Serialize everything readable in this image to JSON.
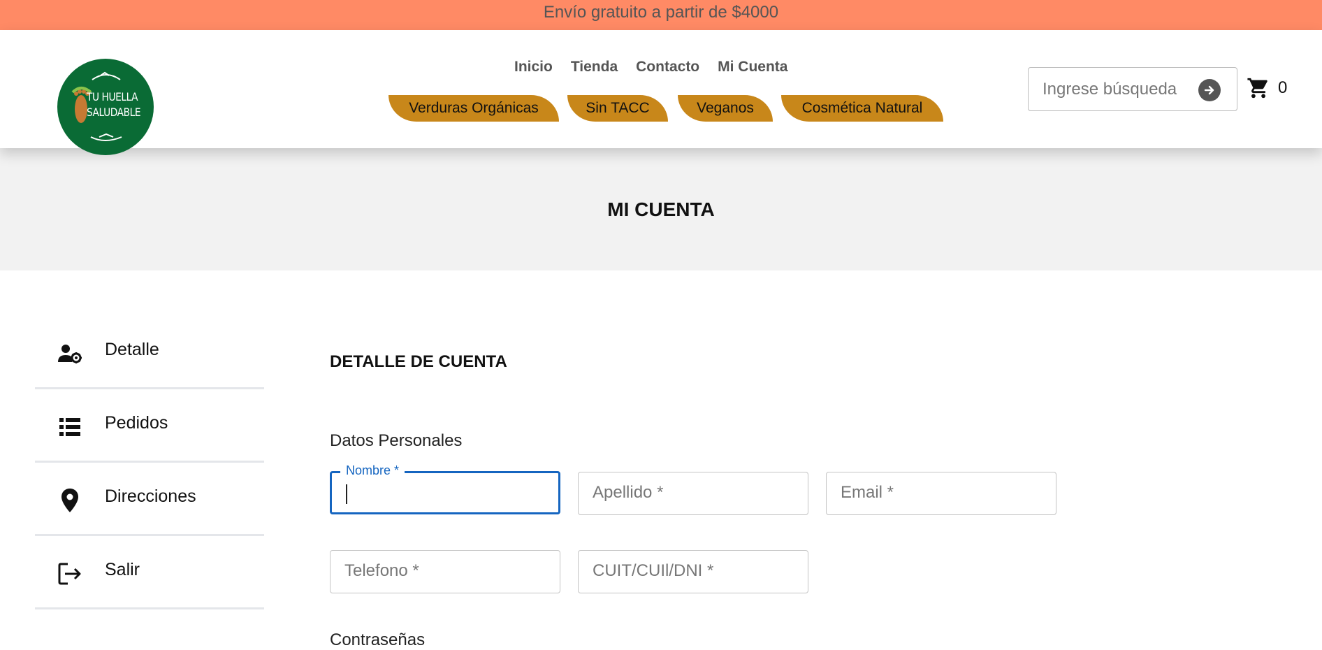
{
  "promo": {
    "text": "Envío gratuito a partir de $4000"
  },
  "logo": {
    "line1": "TU HUELLA",
    "line2": "SALUDABLE"
  },
  "nav": {
    "main": [
      "Inicio",
      "Tienda",
      "Contacto",
      "Mi Cuenta"
    ],
    "categories": [
      "Verduras Orgánicas",
      "Sin TACC",
      "Veganos",
      "Cosmética Natural"
    ]
  },
  "search": {
    "placeholder": "Ingrese búsqueda"
  },
  "cart": {
    "count": "0"
  },
  "page": {
    "title": "MI CUENTA"
  },
  "sidebar": {
    "items": [
      {
        "label": "Detalle",
        "icon": "user-gear-icon"
      },
      {
        "label": "Pedidos",
        "icon": "list-icon"
      },
      {
        "label": "Direcciones",
        "icon": "location-pin-icon"
      },
      {
        "label": "Salir",
        "icon": "logout-icon"
      }
    ]
  },
  "account": {
    "title": "DETALLE DE CUENTA",
    "personal_heading": "Datos Personales",
    "fields": {
      "nombre": {
        "label": "Nombre *",
        "value": ""
      },
      "apellido": {
        "placeholder": "Apellido *"
      },
      "email": {
        "placeholder": "Email *"
      },
      "telefono": {
        "placeholder": "Telefono *"
      },
      "cuit": {
        "placeholder": "CUIT/CUIl/DNI *"
      }
    },
    "passwords_heading": "Contraseñas"
  },
  "colors": {
    "promo_bg": "#ff8a65",
    "category_pill": "#c8871a",
    "logo_green": "#0a6b35",
    "focus_blue": "#1565c0"
  }
}
